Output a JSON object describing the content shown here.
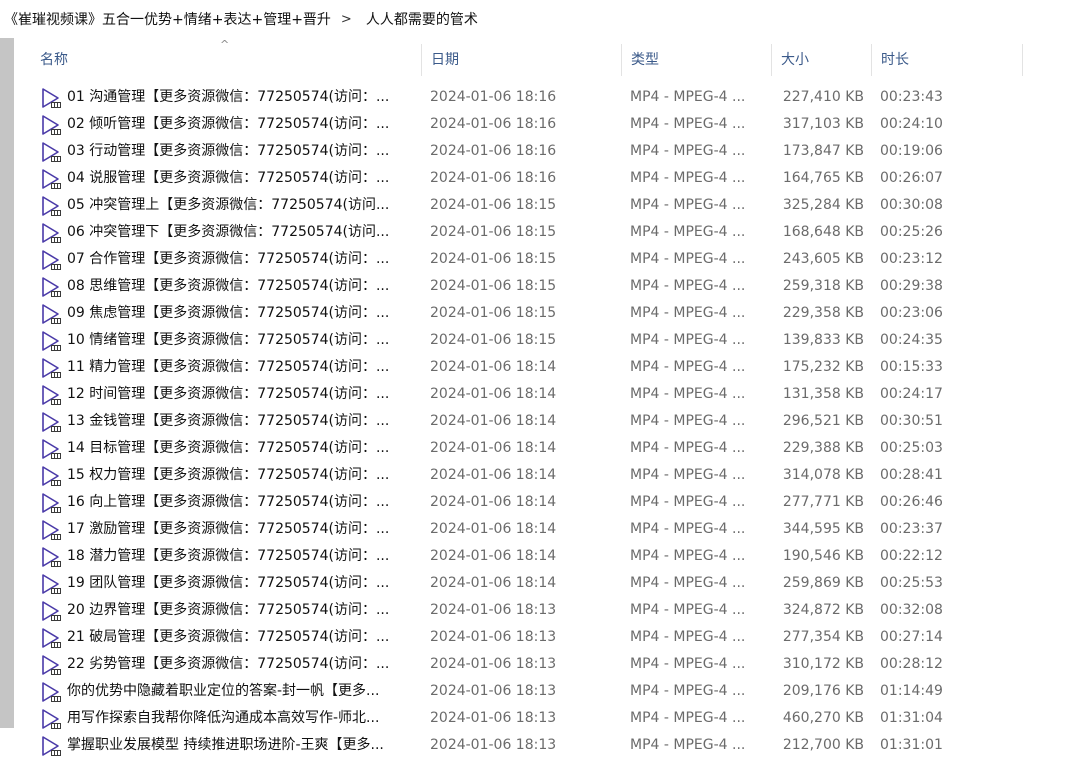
{
  "breadcrumb": {
    "items": [
      "《崔璀视频课》五合一优势+情绪+表达+管理+晋升",
      "人人都需要的管术"
    ],
    "separator": ">"
  },
  "columns": {
    "name": "名称",
    "date": "日期",
    "type": "类型",
    "size": "大小",
    "duration": "时长",
    "sort_indicator": "^"
  },
  "icon": {
    "name": "video-file-icon",
    "color": "#4a3aa8"
  },
  "files": [
    {
      "name": "01 沟通管理【更多资源微信：77250574(访问：...",
      "date": "2024-01-06 18:16",
      "type": "MP4 - MPEG-4 ...",
      "size": "227,410 KB",
      "duration": "00:23:43"
    },
    {
      "name": "02 倾听管理【更多资源微信：77250574(访问：...",
      "date": "2024-01-06 18:16",
      "type": "MP4 - MPEG-4 ...",
      "size": "317,103 KB",
      "duration": "00:24:10"
    },
    {
      "name": "03 行动管理【更多资源微信：77250574(访问：...",
      "date": "2024-01-06 18:16",
      "type": "MP4 - MPEG-4 ...",
      "size": "173,847 KB",
      "duration": "00:19:06"
    },
    {
      "name": "04 说服管理【更多资源微信：77250574(访问：...",
      "date": "2024-01-06 18:16",
      "type": "MP4 - MPEG-4 ...",
      "size": "164,765 KB",
      "duration": "00:26:07"
    },
    {
      "name": "05 冲突管理上【更多资源微信：77250574(访问...",
      "date": "2024-01-06 18:15",
      "type": "MP4 - MPEG-4 ...",
      "size": "325,284 KB",
      "duration": "00:30:08"
    },
    {
      "name": "06 冲突管理下【更多资源微信：77250574(访问...",
      "date": "2024-01-06 18:15",
      "type": "MP4 - MPEG-4 ...",
      "size": "168,648 KB",
      "duration": "00:25:26"
    },
    {
      "name": "07 合作管理【更多资源微信：77250574(访问：...",
      "date": "2024-01-06 18:15",
      "type": "MP4 - MPEG-4 ...",
      "size": "243,605 KB",
      "duration": "00:23:12"
    },
    {
      "name": "08 思维管理【更多资源微信：77250574(访问：...",
      "date": "2024-01-06 18:15",
      "type": "MP4 - MPEG-4 ...",
      "size": "259,318 KB",
      "duration": "00:29:38"
    },
    {
      "name": "09 焦虑管理【更多资源微信：77250574(访问：...",
      "date": "2024-01-06 18:15",
      "type": "MP4 - MPEG-4 ...",
      "size": "229,358 KB",
      "duration": "00:23:06"
    },
    {
      "name": "10 情绪管理【更多资源微信：77250574(访问：...",
      "date": "2024-01-06 18:15",
      "type": "MP4 - MPEG-4 ...",
      "size": "139,833 KB",
      "duration": "00:24:35"
    },
    {
      "name": "11 精力管理【更多资源微信：77250574(访问：...",
      "date": "2024-01-06 18:14",
      "type": "MP4 - MPEG-4 ...",
      "size": "175,232 KB",
      "duration": "00:15:33"
    },
    {
      "name": "12 时间管理【更多资源微信：77250574(访问：...",
      "date": "2024-01-06 18:14",
      "type": "MP4 - MPEG-4 ...",
      "size": "131,358 KB",
      "duration": "00:24:17"
    },
    {
      "name": "13 金钱管理【更多资源微信：77250574(访问：...",
      "date": "2024-01-06 18:14",
      "type": "MP4 - MPEG-4 ...",
      "size": "296,521 KB",
      "duration": "00:30:51"
    },
    {
      "name": "14 目标管理【更多资源微信：77250574(访问：...",
      "date": "2024-01-06 18:14",
      "type": "MP4 - MPEG-4 ...",
      "size": "229,388 KB",
      "duration": "00:25:03"
    },
    {
      "name": "15 权力管理【更多资源微信：77250574(访问：...",
      "date": "2024-01-06 18:14",
      "type": "MP4 - MPEG-4 ...",
      "size": "314,078 KB",
      "duration": "00:28:41"
    },
    {
      "name": "16 向上管理【更多资源微信：77250574(访问：...",
      "date": "2024-01-06 18:14",
      "type": "MP4 - MPEG-4 ...",
      "size": "277,771 KB",
      "duration": "00:26:46"
    },
    {
      "name": "17 激励管理【更多资源微信：77250574(访问：...",
      "date": "2024-01-06 18:14",
      "type": "MP4 - MPEG-4 ...",
      "size": "344,595 KB",
      "duration": "00:23:37"
    },
    {
      "name": "18 潜力管理【更多资源微信：77250574(访问：...",
      "date": "2024-01-06 18:14",
      "type": "MP4 - MPEG-4 ...",
      "size": "190,546 KB",
      "duration": "00:22:12"
    },
    {
      "name": "19 团队管理【更多资源微信：77250574(访问：...",
      "date": "2024-01-06 18:14",
      "type": "MP4 - MPEG-4 ...",
      "size": "259,869 KB",
      "duration": "00:25:53"
    },
    {
      "name": "20 边界管理【更多资源微信：77250574(访问：...",
      "date": "2024-01-06 18:13",
      "type": "MP4 - MPEG-4 ...",
      "size": "324,872 KB",
      "duration": "00:32:08"
    },
    {
      "name": "21 破局管理【更多资源微信：77250574(访问：...",
      "date": "2024-01-06 18:13",
      "type": "MP4 - MPEG-4 ...",
      "size": "277,354 KB",
      "duration": "00:27:14"
    },
    {
      "name": "22 劣势管理【更多资源微信：77250574(访问：...",
      "date": "2024-01-06 18:13",
      "type": "MP4 - MPEG-4 ...",
      "size": "310,172 KB",
      "duration": "00:28:12"
    },
    {
      "name": "你的优势中隐藏着职业定位的答案-封一帆【更多...",
      "date": "2024-01-06 18:13",
      "type": "MP4 - MPEG-4 ...",
      "size": "209,176 KB",
      "duration": "01:14:49"
    },
    {
      "name": "用写作探索自我帮你降低沟通成本高效写作-师北...",
      "date": "2024-01-06 18:13",
      "type": "MP4 - MPEG-4 ...",
      "size": "460,270 KB",
      "duration": "01:31:04"
    },
    {
      "name": "掌握职业发展模型 持续推进职场进阶-王爽【更多...",
      "date": "2024-01-06 18:13",
      "type": "MP4 - MPEG-4 ...",
      "size": "212,700 KB",
      "duration": "01:31:01"
    }
  ]
}
